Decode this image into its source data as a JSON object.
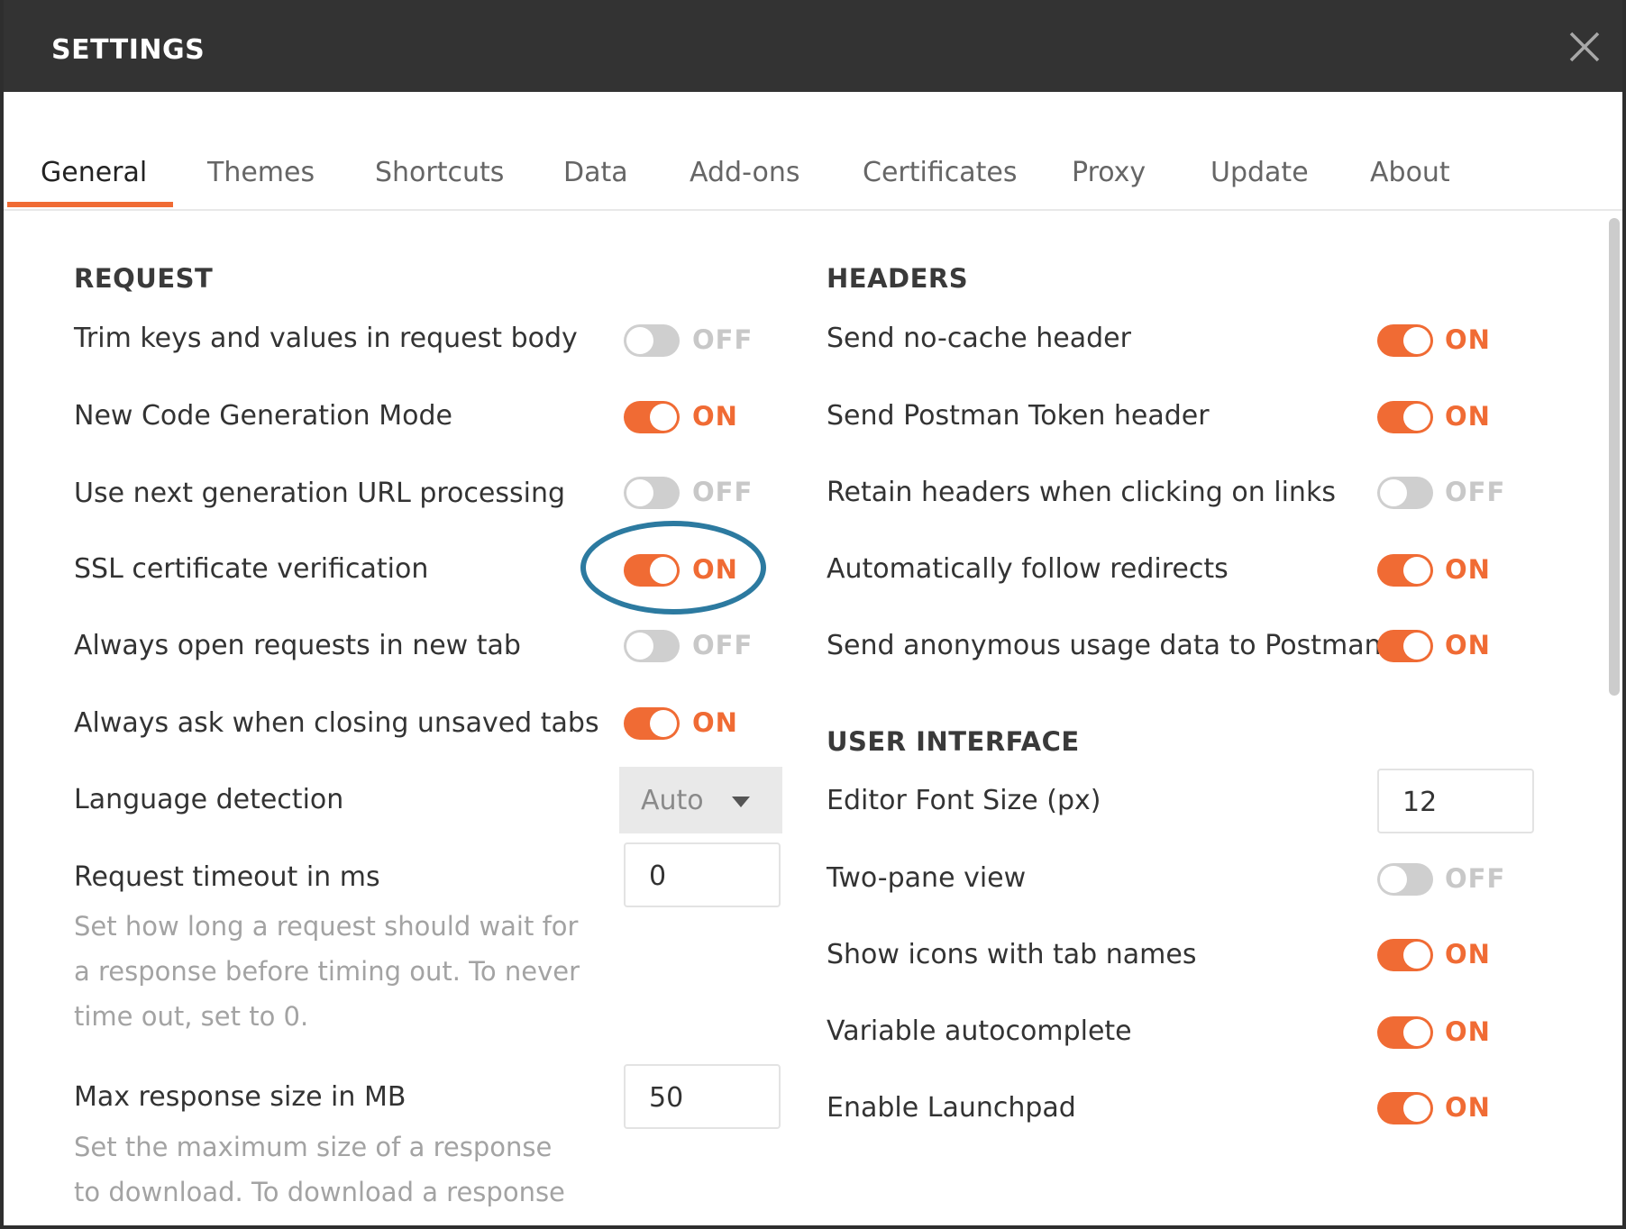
{
  "window": {
    "title": "SETTINGS"
  },
  "tabs": [
    {
      "label": "General",
      "active": true
    },
    {
      "label": "Themes",
      "active": false
    },
    {
      "label": "Shortcuts",
      "active": false
    },
    {
      "label": "Data",
      "active": false
    },
    {
      "label": "Add-ons",
      "active": false
    },
    {
      "label": "Certificates",
      "active": false
    },
    {
      "label": "Proxy",
      "active": false
    },
    {
      "label": "Update",
      "active": false
    },
    {
      "label": "About",
      "active": false
    }
  ],
  "request": {
    "heading": "REQUEST",
    "toggles": [
      {
        "label": "Trim keys and values in request body",
        "state": "OFF"
      },
      {
        "label": "New Code Generation Mode",
        "state": "ON"
      },
      {
        "label": "Use next generation URL processing",
        "state": "OFF"
      },
      {
        "label": "SSL certificate verification",
        "state": "ON"
      },
      {
        "label": "Always open requests in new tab",
        "state": "OFF"
      },
      {
        "label": "Always ask when closing unsaved tabs",
        "state": "ON"
      }
    ],
    "language_detection": {
      "label": "Language detection",
      "value": "Auto"
    },
    "timeout": {
      "label": "Request timeout in ms",
      "value": "0",
      "help": "Set how long a request should wait for a response before timing out. To never time out, set to 0."
    },
    "max_response": {
      "label": "Max response size in MB",
      "value": "50",
      "help": "Set the maximum size of a response to download. To download a response of"
    }
  },
  "headers": {
    "heading": "HEADERS",
    "toggles": [
      {
        "label": "Send no-cache header",
        "state": "ON"
      },
      {
        "label": "Send Postman Token header",
        "state": "ON"
      },
      {
        "label": "Retain headers when clicking on links",
        "state": "OFF"
      },
      {
        "label": "Automatically follow redirects",
        "state": "ON"
      },
      {
        "label": "Send anonymous usage data to Postman",
        "state": "ON"
      }
    ]
  },
  "user_interface": {
    "heading": "USER INTERFACE",
    "font_size": {
      "label": "Editor Font Size (px)",
      "value": "12"
    },
    "toggles": [
      {
        "label": "Two-pane view",
        "state": "OFF"
      },
      {
        "label": "Show icons with tab names",
        "state": "ON"
      },
      {
        "label": "Variable autocomplete",
        "state": "ON"
      },
      {
        "label": "Enable Launchpad",
        "state": "ON"
      }
    ]
  },
  "colors": {
    "accent": "#f06b34",
    "titlebar": "#333333",
    "toggle_off": "#cfcfcf",
    "highlight_ring": "#2c7aa0"
  }
}
